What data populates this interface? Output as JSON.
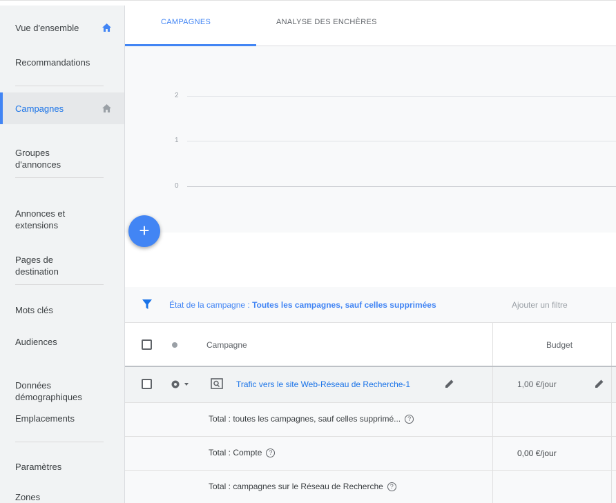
{
  "sidebar": {
    "items": [
      {
        "label": "Vue d'ensemble"
      },
      {
        "label": "Recommandations"
      },
      {
        "label": "Campagnes"
      },
      {
        "label": "Groupes\nd'annonces"
      },
      {
        "label": "Annonces et\nextensions"
      },
      {
        "label": "Pages de\ndestination"
      },
      {
        "label": "Mots clés"
      },
      {
        "label": "Audiences"
      },
      {
        "label": "Données\ndémographiques"
      },
      {
        "label": "Emplacements"
      },
      {
        "label": "Paramètres"
      },
      {
        "label": "Zones"
      }
    ]
  },
  "tabs": [
    {
      "label": "CAMPAGNES"
    },
    {
      "label": "ANALYSE DES ENCHÈRES"
    }
  ],
  "chart": {
    "y_ticks": [
      "2",
      "1",
      "0"
    ]
  },
  "fab": {
    "label": "+"
  },
  "filter": {
    "prefix": "État de la campagne : ",
    "value": "Toutes les campagnes, sauf celles supprimées",
    "add_filter": "Ajouter un filtre"
  },
  "table": {
    "headers": {
      "campaign": "Campagne",
      "budget": "Budget"
    },
    "campaign_row": {
      "name": "Trafic vers le site Web-Réseau de Recherche-1",
      "budget": "1,00 €/jour"
    },
    "totals": [
      {
        "label": "Total : toutes les campagnes, sauf celles supprimé...",
        "budget": ""
      },
      {
        "label": "Total : Compte",
        "budget": "0,00 €/jour"
      },
      {
        "label": "Total : campagnes sur le Réseau de Recherche",
        "budget": ""
      }
    ],
    "help_glyph": "?"
  },
  "colors": {
    "accent": "#4285f4",
    "active_text": "#1a73e8",
    "sidebar_bg": "#f1f3f4",
    "link": "#4285f4"
  }
}
